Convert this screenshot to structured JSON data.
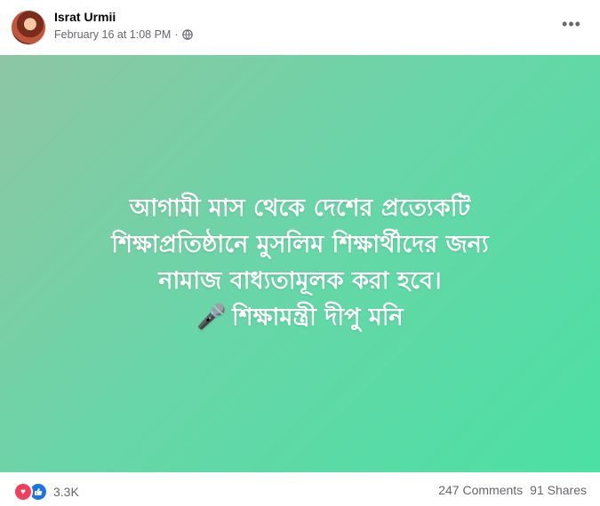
{
  "post": {
    "author": "Israt Urmii",
    "timestamp": "February 16 at 1:08 PM",
    "separator": "·",
    "privacy_icon": "globe-icon",
    "more_icon": "more-options-icon"
  },
  "content": {
    "lines": [
      "আগামী মাস থেকে দেশের প্রত্যেকটি",
      "শিক্ষাপ্রতিষ্ঠানে মুসলিম শিক্ষার্থীদের জন্য",
      "নামাজ বাধ্যতামূলক করা হবে।",
      "শিক্ষামন্ত্রী দীপু মনি"
    ],
    "mic_emoji": "🎤",
    "gradient_colors": [
      "#8ec6a3",
      "#6ad5a8",
      "#4be0a4"
    ]
  },
  "footer": {
    "reaction_count": "3.3K",
    "reaction_icons": [
      "love-icon",
      "like-icon"
    ],
    "comments": "247 Comments",
    "shares": "91 Shares"
  }
}
